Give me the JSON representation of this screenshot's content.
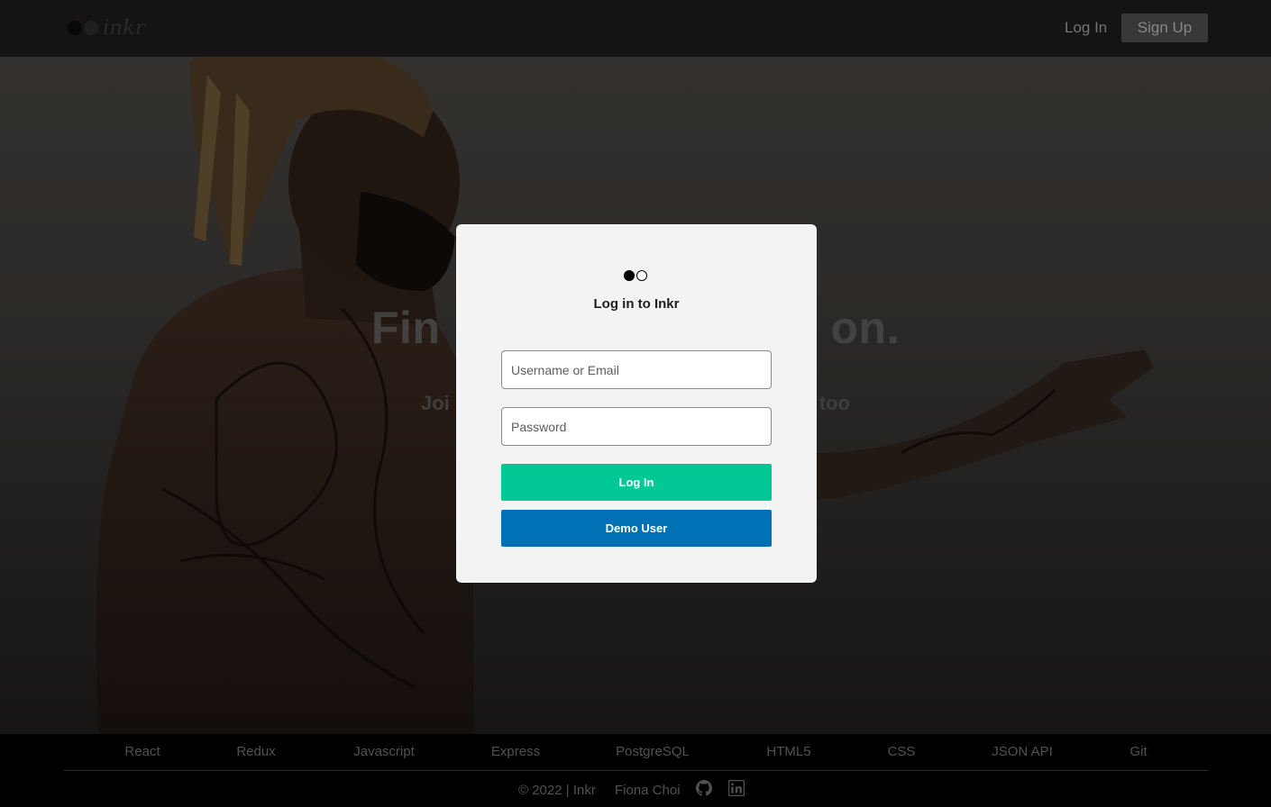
{
  "header": {
    "logo_text": "inkr",
    "login_label": "Log In",
    "signup_label": "Sign Up"
  },
  "hero": {
    "title_left": "Fin",
    "title_right": "on.",
    "subtitle_left": "Joi",
    "subtitle_right": "too"
  },
  "modal": {
    "title": "Log in to Inkr",
    "username_placeholder": "Username or Email",
    "password_placeholder": "Password",
    "login_button": "Log In",
    "demo_button": "Demo User"
  },
  "footer": {
    "tech": [
      "React",
      "Redux",
      "Javascript",
      "Express",
      "PostgreSQL",
      "HTML5",
      "CSS",
      "JSON API",
      "Git"
    ],
    "copyright": "© 2022 | Inkr",
    "author": "Fiona Choi",
    "icons": [
      "github-icon",
      "linkedin-icon"
    ]
  },
  "colors": {
    "login_green": "#02c896",
    "demo_blue": "#0071b4",
    "header_bg": "#1c1a1a",
    "modal_bg": "#f3f3f3"
  }
}
